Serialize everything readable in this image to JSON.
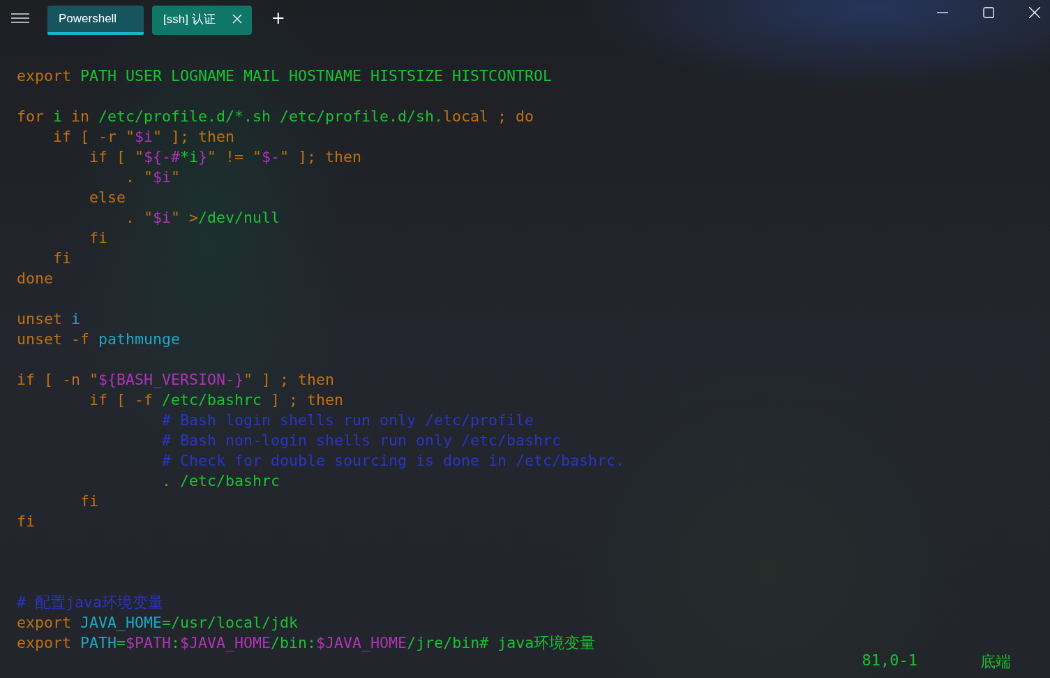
{
  "tabs": [
    {
      "label": "Powershell",
      "selected": true,
      "closable": false
    },
    {
      "label": "[ssh] 认证",
      "selected": false,
      "closable": true
    }
  ],
  "new_tab": "+",
  "lines": [
    {
      "kind": "code",
      "segments": [
        {
          "text": "export ",
          "kind": "keyword"
        },
        {
          "text": "PATH USER LOGNAME MAIL HOSTNAME HISTSIZE HISTCONTROL",
          "kind": "string"
        }
      ]
    },
    {
      "kind": "blank"
    },
    {
      "kind": "code",
      "segments": [
        {
          "text": "for ",
          "kind": "keyword"
        },
        {
          "text": "i ",
          "kind": "string"
        },
        {
          "text": "in ",
          "kind": "keyword"
        },
        {
          "text": "/etc/profile.d/*.sh /etc/profile.d/sh.",
          "kind": "string"
        },
        {
          "text": "local ; do",
          "kind": "keyword"
        }
      ]
    },
    {
      "kind": "code",
      "segments": [
        {
          "text": "    if [ -r \"",
          "kind": "keyword"
        },
        {
          "text": "$i",
          "kind": "variable"
        },
        {
          "text": "\" ]; then",
          "kind": "keyword"
        }
      ]
    },
    {
      "kind": "code",
      "segments": [
        {
          "text": "        if [ \"",
          "kind": "keyword"
        },
        {
          "text": "${-#",
          "kind": "variable"
        },
        {
          "text": "*i",
          "kind": "string"
        },
        {
          "text": "}",
          "kind": "variable"
        },
        {
          "text": "\" != \"",
          "kind": "keyword"
        },
        {
          "text": "$-",
          "kind": "variable"
        },
        {
          "text": "\" ]; then",
          "kind": "keyword"
        }
      ]
    },
    {
      "kind": "code",
      "segments": [
        {
          "text": "            . \"",
          "kind": "keyword"
        },
        {
          "text": "$i",
          "kind": "variable"
        },
        {
          "text": "\"",
          "kind": "keyword"
        }
      ]
    },
    {
      "kind": "code",
      "segments": [
        {
          "text": "        else",
          "kind": "keyword"
        }
      ]
    },
    {
      "kind": "code",
      "segments": [
        {
          "text": "            . \"",
          "kind": "keyword"
        },
        {
          "text": "$i",
          "kind": "variable"
        },
        {
          "text": "\" >",
          "kind": "keyword"
        },
        {
          "text": "/dev/null",
          "kind": "string"
        }
      ]
    },
    {
      "kind": "code",
      "segments": [
        {
          "text": "        fi",
          "kind": "keyword"
        }
      ]
    },
    {
      "kind": "code",
      "segments": [
        {
          "text": "    fi",
          "kind": "keyword"
        }
      ]
    },
    {
      "kind": "code",
      "segments": [
        {
          "text": "done",
          "kind": "keyword"
        }
      ]
    },
    {
      "kind": "blank"
    },
    {
      "kind": "code",
      "segments": [
        {
          "text": "unset ",
          "kind": "keyword"
        },
        {
          "text": "i",
          "kind": "identifier"
        }
      ]
    },
    {
      "kind": "code",
      "segments": [
        {
          "text": "unset -f ",
          "kind": "keyword"
        },
        {
          "text": "pathmunge",
          "kind": "identifier"
        }
      ]
    },
    {
      "kind": "blank"
    },
    {
      "kind": "code",
      "segments": [
        {
          "text": "if [ -n \"",
          "kind": "keyword"
        },
        {
          "text": "${BASH_VERSION-}",
          "kind": "variable"
        },
        {
          "text": "\" ] ; then",
          "kind": "keyword"
        }
      ]
    },
    {
      "kind": "code",
      "segments": [
        {
          "text": "        if [ -f ",
          "kind": "keyword"
        },
        {
          "text": "/etc/bashrc",
          "kind": "string"
        },
        {
          "text": " ] ; then",
          "kind": "keyword"
        }
      ]
    },
    {
      "kind": "code",
      "segments": [
        {
          "text": "                # Bash login shells run only /etc/profile",
          "kind": "comment"
        }
      ]
    },
    {
      "kind": "code",
      "segments": [
        {
          "text": "                # Bash non-login shells run only /etc/bashrc",
          "kind": "comment"
        }
      ]
    },
    {
      "kind": "code",
      "segments": [
        {
          "text": "                # Check for double sourcing is done in /etc/bashrc.",
          "kind": "comment"
        }
      ]
    },
    {
      "kind": "code",
      "segments": [
        {
          "text": "                . ",
          "kind": "keyword"
        },
        {
          "text": "/etc/bashrc",
          "kind": "string"
        }
      ]
    },
    {
      "kind": "code",
      "segments": [
        {
          "text": "       fi",
          "kind": "keyword"
        }
      ]
    },
    {
      "kind": "code",
      "segments": [
        {
          "text": "fi",
          "kind": "keyword"
        }
      ]
    },
    {
      "kind": "blank"
    },
    {
      "kind": "blank"
    },
    {
      "kind": "blank"
    },
    {
      "kind": "code",
      "segments": [
        {
          "text": "# 配置java环境变量",
          "kind": "comment"
        }
      ]
    },
    {
      "kind": "code",
      "segments": [
        {
          "text": "export ",
          "kind": "keyword"
        },
        {
          "text": "JAVA_HOME",
          "kind": "identifier"
        },
        {
          "text": "=/usr/local/jdk",
          "kind": "string"
        }
      ]
    },
    {
      "kind": "code",
      "segments": [
        {
          "text": "export ",
          "kind": "keyword"
        },
        {
          "text": "PATH",
          "kind": "identifier"
        },
        {
          "text": "=",
          "kind": "string"
        },
        {
          "text": "$PATH",
          "kind": "variable"
        },
        {
          "text": ":",
          "kind": "string"
        },
        {
          "text": "$JAVA_HOME",
          "kind": "variable"
        },
        {
          "text": "/bin:",
          "kind": "string"
        },
        {
          "text": "$JAVA_HOME",
          "kind": "variable"
        },
        {
          "text": "/jre/bin# java环境变量",
          "kind": "string"
        }
      ]
    }
  ],
  "status": {
    "position": "81,0-1",
    "location": "底端"
  }
}
